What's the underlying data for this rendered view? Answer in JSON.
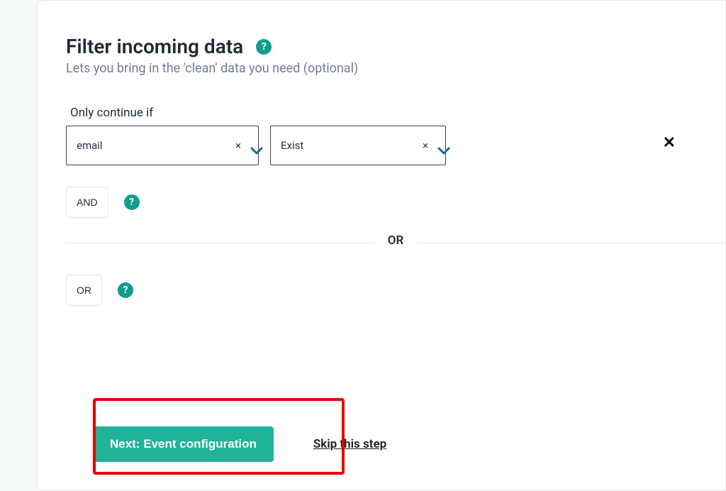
{
  "header": {
    "title": "Filter incoming data",
    "subtitle": "Lets you bring in the 'clean' data you need (optional)",
    "help_glyph": "?"
  },
  "condition": {
    "label": "Only continue if",
    "field": "email",
    "operator": "Exist",
    "clear_glyph": "×",
    "remove_glyph": "✕"
  },
  "logic": {
    "and_label": "AND",
    "or_label": "OR",
    "help_glyph": "?",
    "divider_label": "OR"
  },
  "footer": {
    "next_label": "Next: Event configuration",
    "skip_label": "Skip this step"
  },
  "colors": {
    "accent": "#21b39a",
    "help_bg": "#0f9e8b",
    "highlight": "#e30000"
  }
}
